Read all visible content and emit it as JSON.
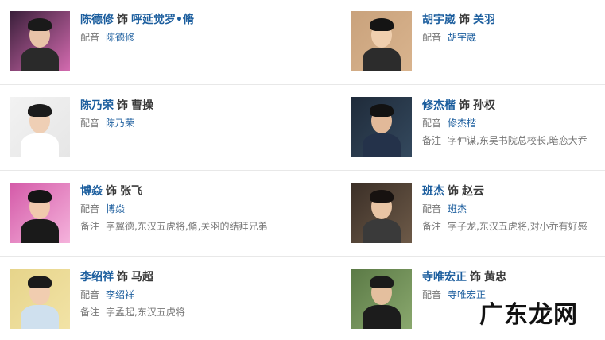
{
  "cast": [
    {
      "actor": "陈德修",
      "shi": "饰",
      "role": "呼延觉罗•脩",
      "dub_label": "配音",
      "dub": "陈德修",
      "note_label": "",
      "note": "",
      "photo": {
        "bg": "#3a1f3a",
        "accent": "#d46bb0",
        "skin": "#e8c3a8",
        "hair": "#1a1a1a",
        "cloth": "#2a2a2a"
      }
    },
    {
      "actor": "胡宇崴",
      "shi": "饰",
      "role": "关羽",
      "dub_label": "配音",
      "dub": "胡宇崴",
      "note_label": "",
      "note": "",
      "photo": {
        "bg": "#c9a27c",
        "accent": "#d9b48e",
        "skin": "#f0cfae",
        "hair": "#141414",
        "cloth": "#2c2c2c"
      }
    },
    {
      "actor": "陈乃荣",
      "shi": "饰",
      "role": "曹操",
      "dub_label": "配音",
      "dub": "陈乃荣",
      "note_label": "",
      "note": "",
      "photo": {
        "bg": "#f2f2f2",
        "accent": "#e6e6e6",
        "skin": "#efcfb5",
        "hair": "#1b1b1b",
        "cloth": "#ffffff"
      }
    },
    {
      "actor": "修杰楷",
      "shi": "饰",
      "role": "孙权",
      "dub_label": "配音",
      "dub": "修杰楷",
      "note_label": "备注",
      "note": "字仲谋,东吴书院总校长,暗恋大乔",
      "photo": {
        "bg": "#1f2b3a",
        "accent": "#34495e",
        "skin": "#e2b999",
        "hair": "#121212",
        "cloth": "#24324a"
      }
    },
    {
      "actor": "博焱",
      "shi": "饰",
      "role": "张飞",
      "dub_label": "配音",
      "dub": "博焱",
      "note_label": "备注",
      "note": "字翼德,东汉五虎将,脩,关羽的结拜兄弟",
      "photo": {
        "bg": "#d45aa8",
        "accent": "#f5b3dc",
        "skin": "#f0c9ad",
        "hair": "#151515",
        "cloth": "#1a1a1a"
      }
    },
    {
      "actor": "班杰",
      "shi": "饰",
      "role": "赵云",
      "dub_label": "配音",
      "dub": "班杰",
      "note_label": "备注",
      "note": "字子龙,东汉五虎将,对小乔有好感",
      "photo": {
        "bg": "#3b2f27",
        "accent": "#6d5a48",
        "skin": "#e8c4a4",
        "hair": "#171210",
        "cloth": "#3a3a3a"
      }
    },
    {
      "actor": "李绍祥",
      "shi": "饰",
      "role": "马超",
      "dub_label": "配音",
      "dub": "李绍祥",
      "note_label": "备注",
      "note": "字孟起,东汉五虎将",
      "photo": {
        "bg": "#e6d48a",
        "accent": "#f2e3a6",
        "skin": "#f1cdb0",
        "hair": "#1a1a1a",
        "cloth": "#cfe0ee"
      }
    },
    {
      "actor": "寺唯宏正",
      "shi": "饰",
      "role": "黄忠",
      "dub_label": "配音",
      "dub": "寺唯宏正",
      "note_label": "",
      "note": "",
      "photo": {
        "bg": "#5b7a46",
        "accent": "#8aa86e",
        "skin": "#e4bf9e",
        "hair": "#1a1a1a",
        "cloth": "#1c1c1c"
      }
    }
  ],
  "watermark": "广东龙网"
}
